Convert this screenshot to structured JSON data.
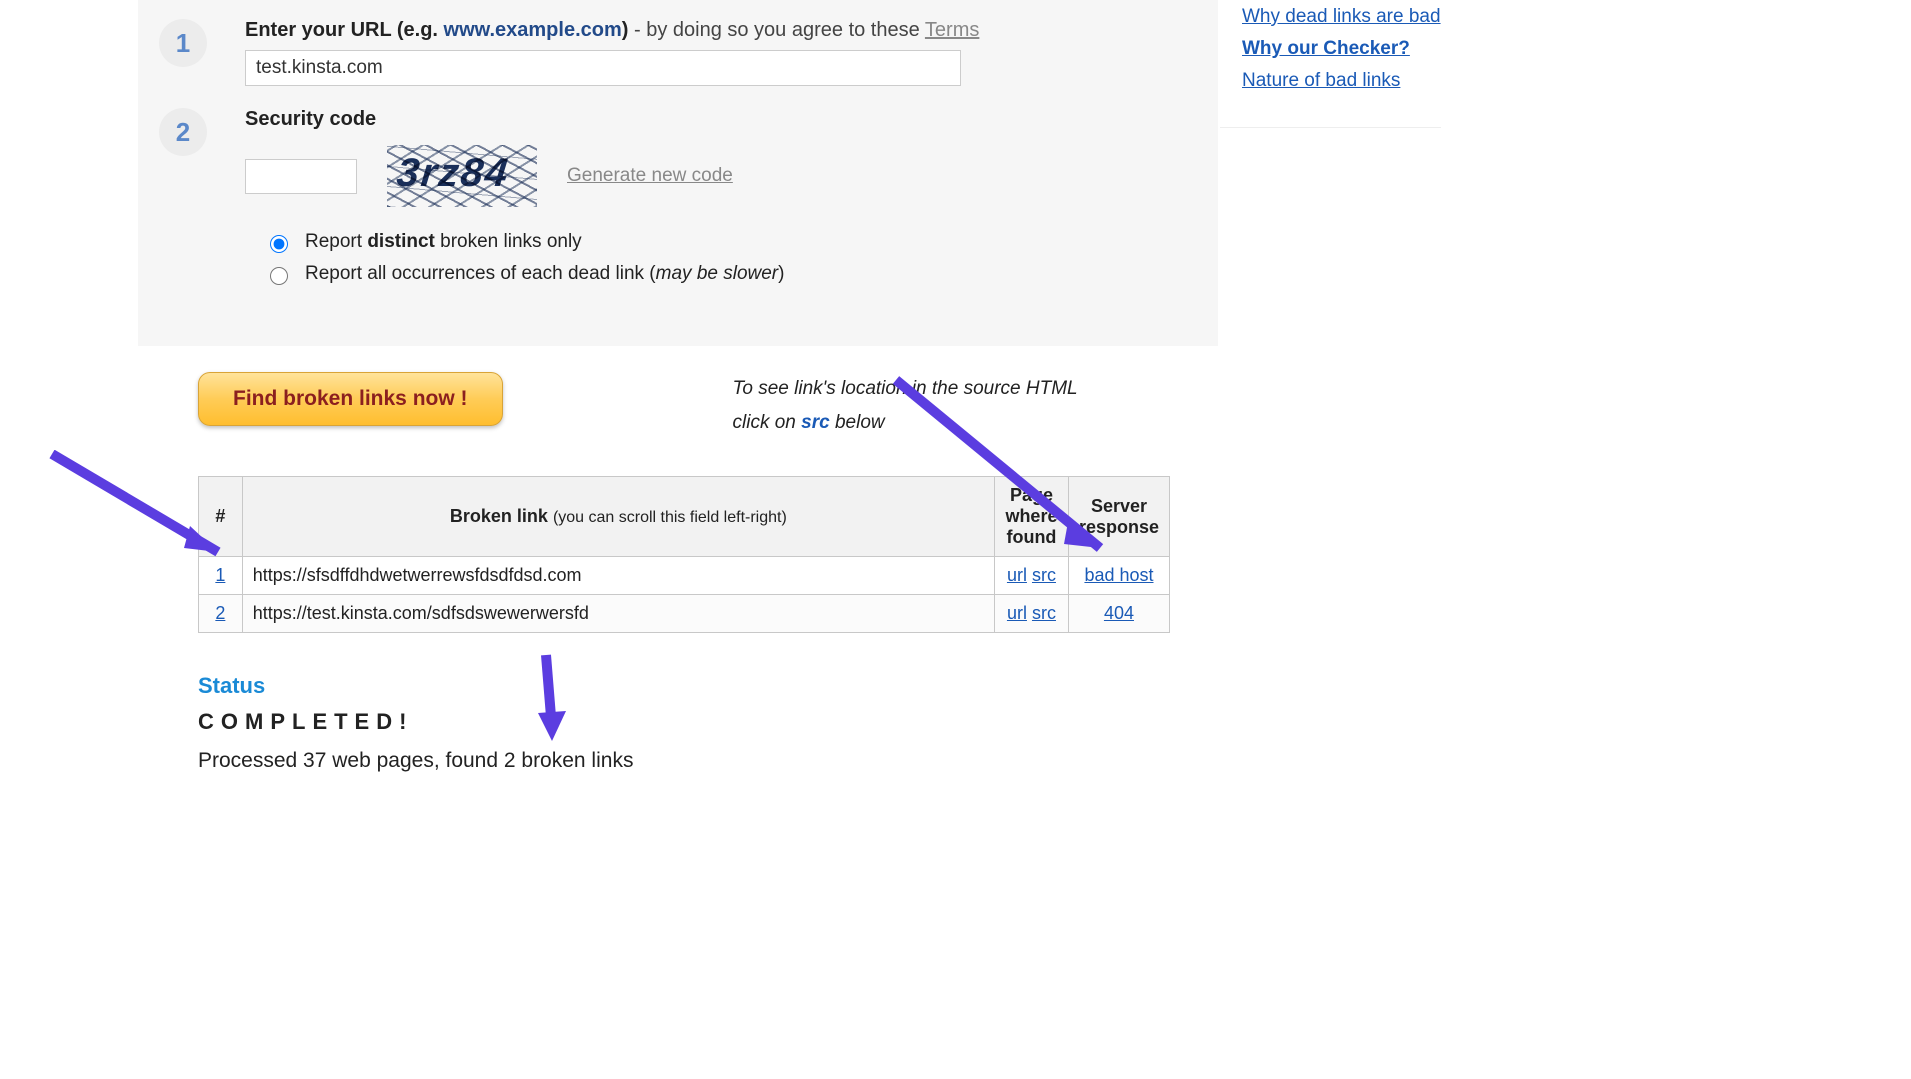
{
  "step1": {
    "label_prefix": "Enter your URL (e.g. ",
    "label_example": "www.example.com",
    "label_suffix": ") ",
    "agree_text": "- by doing so you agree to these ",
    "terms_text": "Terms",
    "value": "test.kinsta.com"
  },
  "step2": {
    "label": "Security code",
    "captcha_text": "3rz84",
    "generate_label": "Generate new code"
  },
  "radios": {
    "opt1_pre": "Report ",
    "opt1_bold": "distinct",
    "opt1_post": " broken links only",
    "opt2_pre": "Report all occurrences of each dead link (",
    "opt2_em": "may be slower",
    "opt2_post": ")"
  },
  "find_button": "Find broken links now !",
  "hint": {
    "line1": "To see link's location in the source HTML",
    "line2_pre": "click on ",
    "line2_src": "src",
    "line2_post": " below"
  },
  "table": {
    "col_num": "#",
    "col_link": "Broken link",
    "col_link_sub": "(you can scroll this field left-right)",
    "col_page": "Page where found",
    "col_resp": "Server response",
    "url_label": "url",
    "src_label": "src",
    "rows": [
      {
        "n": "1",
        "url": "https://sfsdffdhdwetwerrewsfdsdfdsd.com",
        "resp": "bad host"
      },
      {
        "n": "2",
        "url": "https://test.kinsta.com/sdfsdswewerwersfd",
        "resp": "404"
      }
    ]
  },
  "status": {
    "title": "Status",
    "done": "COMPLETED!",
    "msg": "Processed 37 web pages, found 2 broken links"
  },
  "sidebar": {
    "links": [
      {
        "text": "Why dead links are bad",
        "active": false
      },
      {
        "text": "Why our Checker?",
        "active": true
      },
      {
        "text": "Nature of bad links",
        "active": false
      }
    ]
  }
}
